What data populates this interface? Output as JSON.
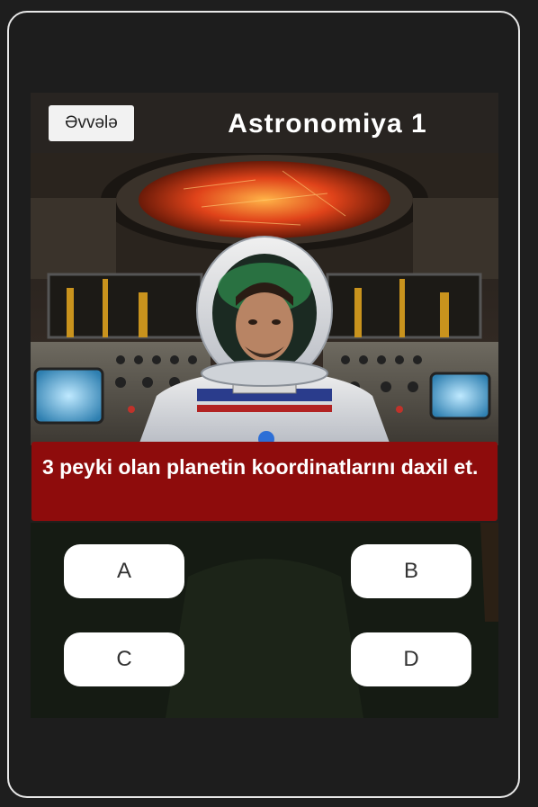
{
  "header": {
    "back_label": "Əvvələ",
    "title": "Astronomiya 1"
  },
  "question": {
    "text": "3 peyki olan planetin koordinatlarını daxil et."
  },
  "answers": [
    {
      "label": "A"
    },
    {
      "label": "B"
    },
    {
      "label": "C"
    },
    {
      "label": "D"
    }
  ],
  "colors": {
    "question_bg": "#8e0c0c",
    "header_bg": "#282421",
    "page_bg": "#1e1e1e",
    "button_bg": "#ffffff"
  },
  "illustration": {
    "icon": "astronaut-in-spaceship-cockpit-image"
  }
}
